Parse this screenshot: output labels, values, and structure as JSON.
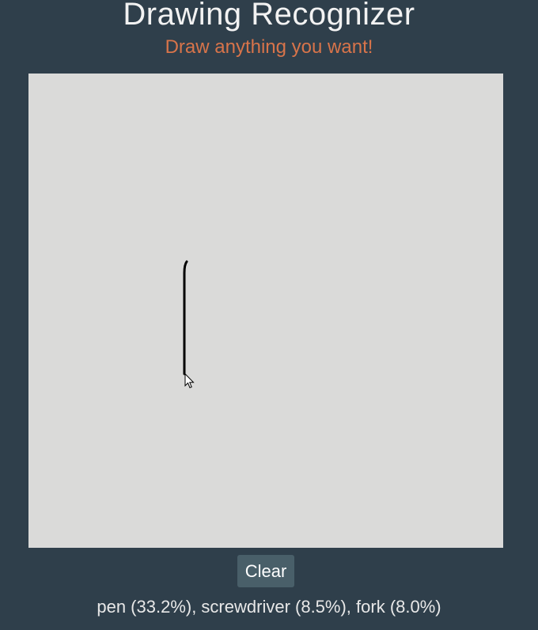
{
  "header": {
    "title": "Drawing Recognizer",
    "subtitle": "Draw anything you want!"
  },
  "canvas": {
    "background_color": "#dadad9",
    "stroke_color": "#000000"
  },
  "controls": {
    "clear_label": "Clear"
  },
  "predictions": {
    "text": "pen (33.2%), screwdriver (8.5%), fork (8.0%)",
    "items": [
      {
        "label": "pen",
        "confidence_percent": 33.2
      },
      {
        "label": "screwdriver",
        "confidence_percent": 8.5
      },
      {
        "label": "fork",
        "confidence_percent": 8.0
      }
    ]
  },
  "colors": {
    "background": "#2f3f4b",
    "title": "#f2f2f2",
    "subtitle": "#d8744a",
    "button": "#495f69"
  },
  "cursor": {
    "icon": "mouse-pointer-icon"
  }
}
